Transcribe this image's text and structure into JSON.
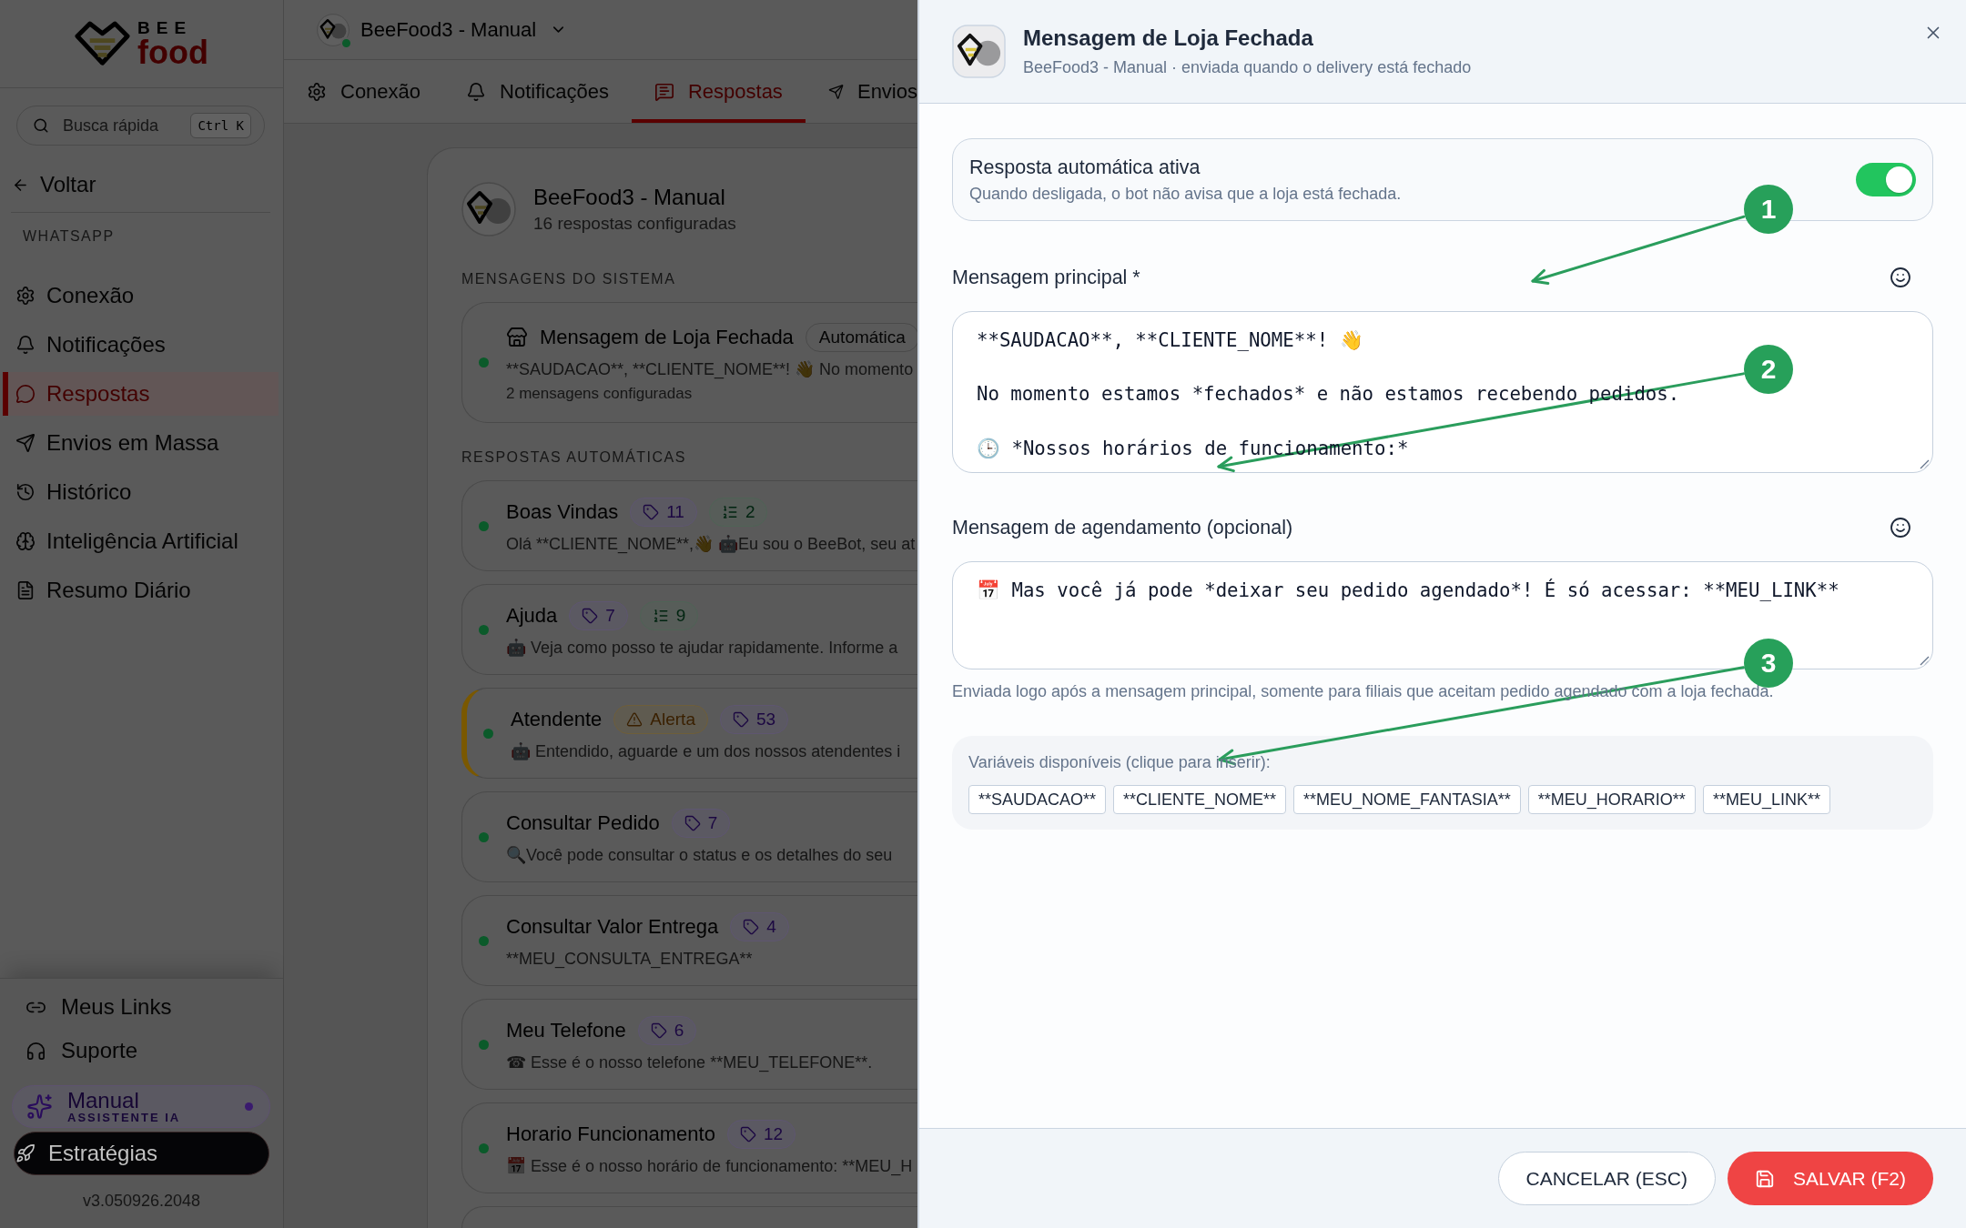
{
  "sidebar": {
    "logo": {
      "top": "BEE",
      "bottom": "food"
    },
    "search": {
      "placeholder": "Busca rápida",
      "shortcut": "Ctrl K"
    },
    "back": "Voltar",
    "section": "WHATSAPP",
    "items": [
      {
        "label": "Conexão",
        "selected": false
      },
      {
        "label": "Notificações",
        "selected": false
      },
      {
        "label": "Respostas",
        "selected": true
      },
      {
        "label": "Envios em Massa",
        "selected": false
      },
      {
        "label": "Histórico",
        "selected": false
      },
      {
        "label": "Inteligência Artificial",
        "selected": false
      },
      {
        "label": "Resumo Diário",
        "selected": false
      }
    ],
    "footer_links": [
      "Meus Links",
      "Suporte"
    ],
    "assistant": {
      "name": "Manual",
      "role": "ASSISTENTE IA"
    },
    "strategies": "Estratégias",
    "version": "v3.050926.2048"
  },
  "topbar": {
    "account": "BeeFood3 - Manual",
    "online": true
  },
  "tabs": [
    {
      "label": "Conexão",
      "selected": false
    },
    {
      "label": "Notificações",
      "selected": false
    },
    {
      "label": "Respostas",
      "selected": true
    },
    {
      "label": "Envios",
      "selected": false
    }
  ],
  "responses_panel": {
    "title": "BeeFood3 - Manual",
    "subtitle": "16 respostas configuradas",
    "system_section": "MENSAGENS DO SISTEMA",
    "system_messages": [
      {
        "title": "Mensagem de Loja Fechada",
        "badge": "Automática",
        "preview": "**SAUDACAO**, **CLIENTE_NOME**! 👋 No momento",
        "meta": "2 mensagens configuradas",
        "active": true
      }
    ],
    "auto_section": "RESPOSTAS AUTOMÁTICAS",
    "responses": [
      {
        "title": "Boas Vindas",
        "badges": [
          {
            "kind": "tags",
            "text": "11"
          },
          {
            "kind": "steps",
            "text": "2"
          }
        ],
        "preview": "Olá **CLIENTE_NOME**,👋 🤖Eu sou o BeeBot, seu at",
        "active": true
      },
      {
        "title": "Ajuda",
        "badges": [
          {
            "kind": "tags",
            "text": "7"
          },
          {
            "kind": "steps",
            "text": "9"
          }
        ],
        "preview": "🤖 Veja como posso te ajudar rapidamente. Informe a",
        "active": true
      },
      {
        "title": "Atendente",
        "badges": [
          {
            "kind": "alert",
            "text": "Alerta"
          },
          {
            "kind": "tags",
            "text": "53"
          }
        ],
        "preview": "🤖 Entendido, aguarde e um dos nossos atendentes i",
        "active": true
      },
      {
        "title": "Consultar Pedido",
        "badges": [
          {
            "kind": "tags",
            "text": "7"
          }
        ],
        "preview": "🔍Você pode consultar o status e os detalhes do seu",
        "active": true
      },
      {
        "title": "Consultar Valor Entrega",
        "badges": [
          {
            "kind": "tags",
            "text": "4"
          }
        ],
        "preview": "**MEU_CONSULTA_ENTREGA**",
        "active": true
      },
      {
        "title": "Meu Telefone",
        "badges": [
          {
            "kind": "tags",
            "text": "6"
          }
        ],
        "preview": "☎ Esse é o nosso telefone **MEU_TELEFONE**.",
        "active": true
      },
      {
        "title": "Horario Funcionamento",
        "badges": [
          {
            "kind": "tags",
            "text": "12"
          }
        ],
        "preview": "📅 Esse é o nosso horário de funcionamento: **MEU_H",
        "active": true
      }
    ]
  },
  "dialog": {
    "title": "Mensagem de Loja Fechada",
    "subtitle": "BeeFood3 - Manual · enviada quando o delivery está fechado",
    "auto_reply": {
      "label": "Resposta automática ativa",
      "description": "Quando desligada, o bot não avisa que a loja está fechada.",
      "on": true
    },
    "main_message": {
      "label": "Mensagem principal *",
      "value": "**SAUDACAO**, **CLIENTE_NOME**! 👋\n\nNo momento estamos *fechados* e não estamos recebendo pedidos.\n\n🕒 *Nossos horários de funcionamento:*"
    },
    "schedule_message": {
      "label": "Mensagem de agendamento (opcional)",
      "value": "📅 Mas você já pode *deixar seu pedido agendado*! É só acessar: **MEU_LINK**",
      "hint": "Enviada logo após a mensagem principal, somente para filiais que aceitam pedido agendado com a loja fechada."
    },
    "variables": {
      "label": "Variáveis disponíveis (clique para inserir):",
      "items": [
        "**SAUDACAO**",
        "**CLIENTE_NOME**",
        "**MEU_NOME_FANTASIA**",
        "**MEU_HORARIO**",
        "**MEU_LINK**"
      ]
    },
    "buttons": {
      "cancel": "CANCELAR (ESC)",
      "save": "SALVAR (F2)"
    }
  },
  "annotations": [
    {
      "label": "1"
    },
    {
      "label": "2"
    },
    {
      "label": "3"
    }
  ]
}
